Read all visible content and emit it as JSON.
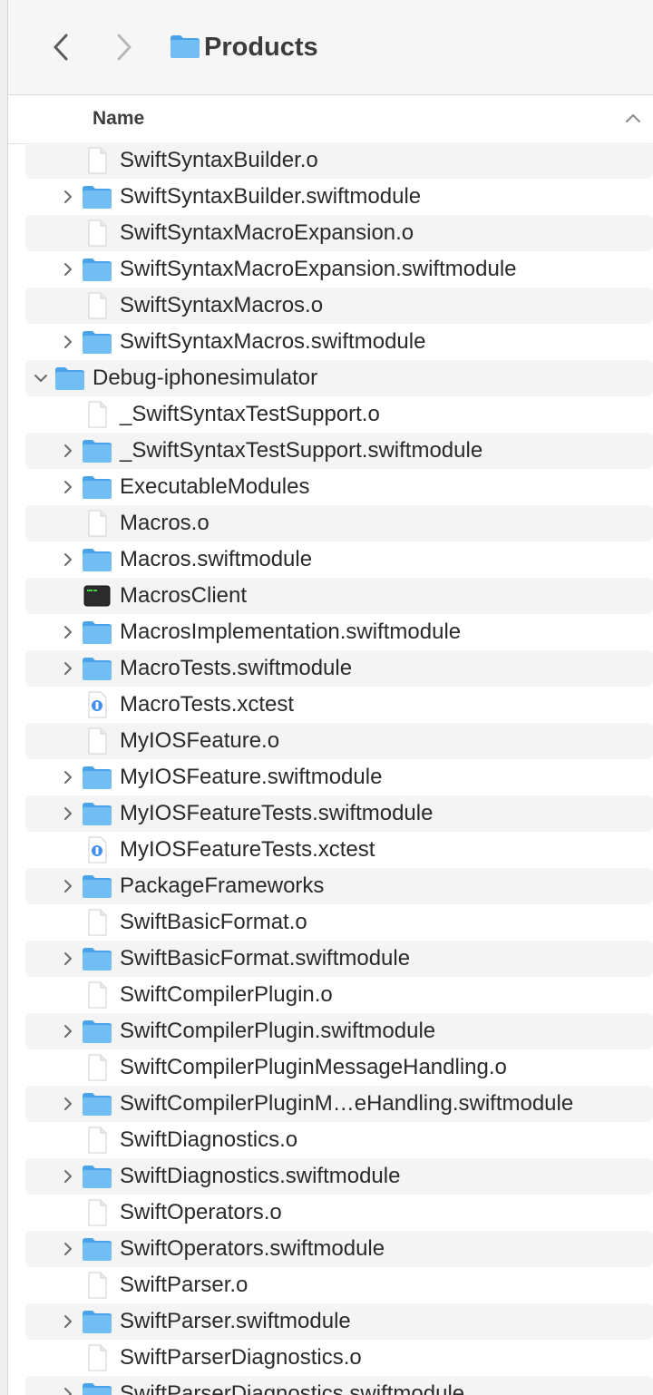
{
  "toolbar": {
    "title": "Products",
    "back_icon": "chevron-left-icon",
    "forward_icon": "chevron-right-icon",
    "folder_icon": "folder-icon"
  },
  "header": {
    "name_column": "Name",
    "sort_icon": "chevron-up-icon"
  },
  "colors": {
    "folder": "#5aaef0",
    "folder_tab": "#7ec3f5",
    "row_alt": "#f4f4f5"
  },
  "rows": [
    {
      "label": "SwiftSyntaxBuilder.o",
      "kind": "file",
      "level": 1,
      "expandable": false
    },
    {
      "label": "SwiftSyntaxBuilder.swiftmodule",
      "kind": "folder",
      "level": 1,
      "expandable": true,
      "expanded": false
    },
    {
      "label": "SwiftSyntaxMacroExpansion.o",
      "kind": "file",
      "level": 1,
      "expandable": false
    },
    {
      "label": "SwiftSyntaxMacroExpansion.swiftmodule",
      "kind": "folder",
      "level": 1,
      "expandable": true,
      "expanded": false
    },
    {
      "label": "SwiftSyntaxMacros.o",
      "kind": "file",
      "level": 1,
      "expandable": false
    },
    {
      "label": "SwiftSyntaxMacros.swiftmodule",
      "kind": "folder",
      "level": 1,
      "expandable": true,
      "expanded": false
    },
    {
      "label": "Debug-iphonesimulator",
      "kind": "folder",
      "level": 0,
      "expandable": true,
      "expanded": true
    },
    {
      "label": "_SwiftSyntaxTestSupport.o",
      "kind": "file",
      "level": 1,
      "expandable": false
    },
    {
      "label": "_SwiftSyntaxTestSupport.swiftmodule",
      "kind": "folder",
      "level": 1,
      "expandable": true,
      "expanded": false
    },
    {
      "label": "ExecutableModules",
      "kind": "folder",
      "level": 1,
      "expandable": true,
      "expanded": false
    },
    {
      "label": "Macros.o",
      "kind": "file",
      "level": 1,
      "expandable": false
    },
    {
      "label": "Macros.swiftmodule",
      "kind": "folder",
      "level": 1,
      "expandable": true,
      "expanded": false
    },
    {
      "label": "MacrosClient",
      "kind": "exec",
      "level": 1,
      "expandable": false
    },
    {
      "label": "MacrosImplementation.swiftmodule",
      "kind": "folder",
      "level": 1,
      "expandable": true,
      "expanded": false
    },
    {
      "label": "MacroTests.swiftmodule",
      "kind": "folder",
      "level": 1,
      "expandable": true,
      "expanded": false
    },
    {
      "label": "MacroTests.xctest",
      "kind": "xctest",
      "level": 1,
      "expandable": false
    },
    {
      "label": "MyIOSFeature.o",
      "kind": "file",
      "level": 1,
      "expandable": false
    },
    {
      "label": "MyIOSFeature.swiftmodule",
      "kind": "folder",
      "level": 1,
      "expandable": true,
      "expanded": false
    },
    {
      "label": "MyIOSFeatureTests.swiftmodule",
      "kind": "folder",
      "level": 1,
      "expandable": true,
      "expanded": false
    },
    {
      "label": "MyIOSFeatureTests.xctest",
      "kind": "xctest",
      "level": 1,
      "expandable": false
    },
    {
      "label": "PackageFrameworks",
      "kind": "folder",
      "level": 1,
      "expandable": true,
      "expanded": false
    },
    {
      "label": "SwiftBasicFormat.o",
      "kind": "file",
      "level": 1,
      "expandable": false
    },
    {
      "label": "SwiftBasicFormat.swiftmodule",
      "kind": "folder",
      "level": 1,
      "expandable": true,
      "expanded": false
    },
    {
      "label": "SwiftCompilerPlugin.o",
      "kind": "file",
      "level": 1,
      "expandable": false
    },
    {
      "label": "SwiftCompilerPlugin.swiftmodule",
      "kind": "folder",
      "level": 1,
      "expandable": true,
      "expanded": false
    },
    {
      "label": "SwiftCompilerPluginMessageHandling.o",
      "kind": "file",
      "level": 1,
      "expandable": false
    },
    {
      "label": "SwiftCompilerPluginM…eHandling.swiftmodule",
      "kind": "folder",
      "level": 1,
      "expandable": true,
      "expanded": false
    },
    {
      "label": "SwiftDiagnostics.o",
      "kind": "file",
      "level": 1,
      "expandable": false
    },
    {
      "label": "SwiftDiagnostics.swiftmodule",
      "kind": "folder",
      "level": 1,
      "expandable": true,
      "expanded": false
    },
    {
      "label": "SwiftOperators.o",
      "kind": "file",
      "level": 1,
      "expandable": false
    },
    {
      "label": "SwiftOperators.swiftmodule",
      "kind": "folder",
      "level": 1,
      "expandable": true,
      "expanded": false
    },
    {
      "label": "SwiftParser.o",
      "kind": "file",
      "level": 1,
      "expandable": false
    },
    {
      "label": "SwiftParser.swiftmodule",
      "kind": "folder",
      "level": 1,
      "expandable": true,
      "expanded": false
    },
    {
      "label": "SwiftParserDiagnostics.o",
      "kind": "file",
      "level": 1,
      "expandable": false
    },
    {
      "label": "SwiftParserDiagnostics.swiftmodule",
      "kind": "folder",
      "level": 1,
      "expandable": true,
      "expanded": false
    }
  ]
}
